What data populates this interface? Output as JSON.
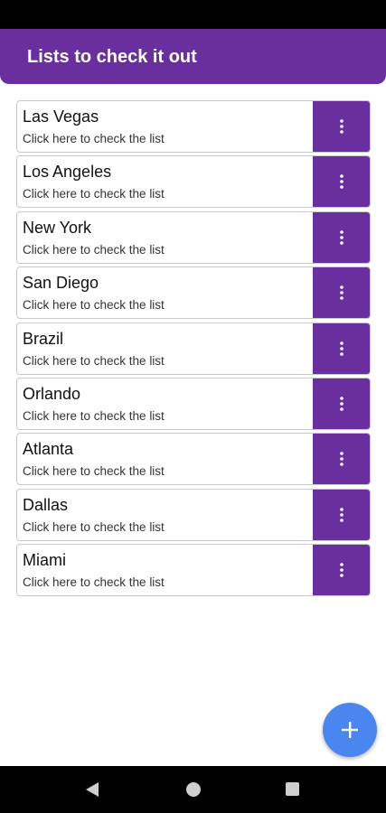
{
  "app_bar": {
    "title": "Lists to check it out"
  },
  "lists": [
    {
      "title": "Las Vegas",
      "subtitle": "Click here to check the list"
    },
    {
      "title": "Los Angeles",
      "subtitle": "Click here to check the list"
    },
    {
      "title": "New York",
      "subtitle": "Click here to check the list"
    },
    {
      "title": "San Diego",
      "subtitle": "Click here to check the list"
    },
    {
      "title": "Brazil",
      "subtitle": "Click here to check the list"
    },
    {
      "title": "Orlando",
      "subtitle": "Click here to check the list"
    },
    {
      "title": "Atlanta",
      "subtitle": "Click here to check the list"
    },
    {
      "title": "Dallas",
      "subtitle": "Click here to check the list"
    },
    {
      "title": "Miami",
      "subtitle": "Click here to check the list"
    }
  ],
  "icons": {
    "item_menu": "more-vertical-icon",
    "fab": "plus-icon",
    "nav_back": "back-triangle-icon",
    "nav_home": "home-circle-icon",
    "nav_recents": "recents-square-icon"
  },
  "colors": {
    "primary": "#6a2f9e",
    "fab": "#4a86f0",
    "system_bars": "#000000",
    "background": "#ffffff"
  }
}
